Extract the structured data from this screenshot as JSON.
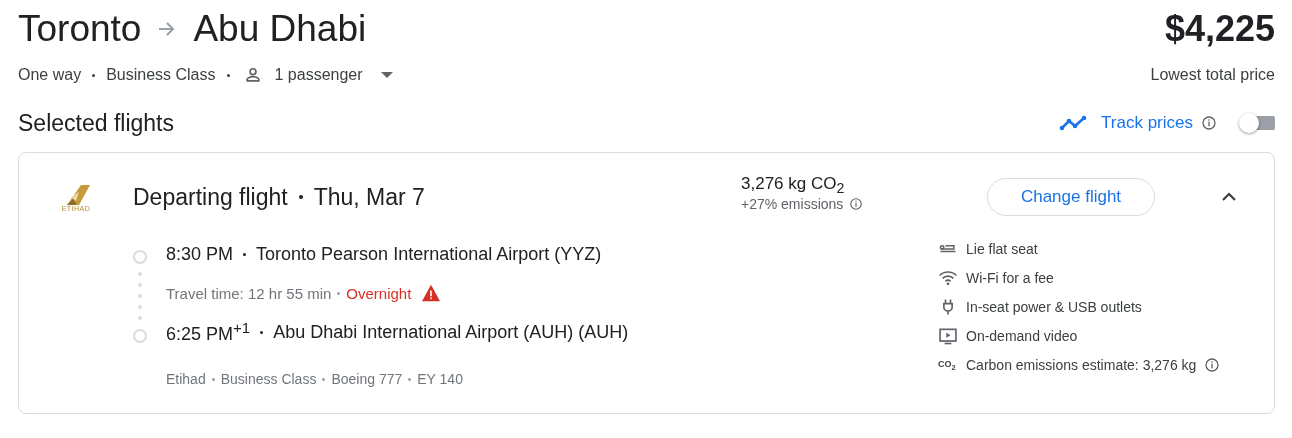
{
  "header": {
    "origin": "Toronto",
    "destination": "Abu Dhabi",
    "price": "$4,225",
    "price_label": "Lowest total price"
  },
  "trip": {
    "trip_type": "One way",
    "cabin": "Business Class",
    "passengers": "1 passenger"
  },
  "section_title": "Selected flights",
  "track_prices": {
    "label": "Track prices",
    "on": false
  },
  "flight": {
    "airline_logo": "ETIHAD",
    "title": "Departing flight",
    "date": "Thu, Mar 7",
    "emissions": "3,276 kg CO$_{2}$",
    "emissions_delta": "+27% emissions",
    "change_button": "Change flight",
    "expanded": true,
    "departure": {
      "time": "8:30 PM",
      "airport": "Toronto Pearson International Airport (YYZ)"
    },
    "travel_time": "Travel time: 12 hr 55 min",
    "overnight": "Overnight",
    "arrival": {
      "time": "6:25 PM$^{+1}$",
      "airport": "Abu Dhabi International Airport (AUH) (AUH)"
    },
    "details": [
      "Etihad",
      "Business Class",
      "Boeing 777",
      "EY 140"
    ],
    "amenities": [
      {
        "kind": "seat",
        "label": "Lie flat seat"
      },
      {
        "kind": "wifi",
        "label": "Wi-Fi for a fee"
      },
      {
        "kind": "power",
        "label": "In-seat power & USB outlets"
      },
      {
        "kind": "video",
        "label": "On-demand video"
      },
      {
        "kind": "co2",
        "icon_text": "CO$_{2}$",
        "label": "Carbon emissions estimate: 3,276 kg",
        "info": true
      }
    ]
  }
}
